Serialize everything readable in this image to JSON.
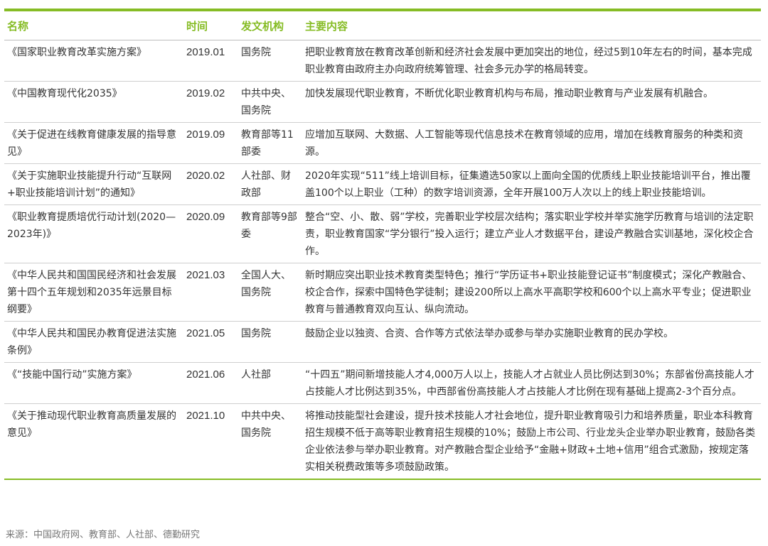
{
  "colors": {
    "accent": "#86bc25",
    "text": "#333333",
    "rule": "#cfcfcf"
  },
  "table": {
    "headers": {
      "name": "名称",
      "time": "时间",
      "org": "发文机构",
      "content": "主要内容"
    },
    "rows": [
      {
        "name": "《国家职业教育改革实施方案》",
        "time": "2019.01",
        "org": "国务院",
        "content": "把职业教育放在教育改革创新和经济社会发展中更加突出的地位，经过5到10年左右的时间，基本完成职业教育由政府主办向政府统筹管理、社会多元办学的格局转变。"
      },
      {
        "name": "《中国教育现代化2035》",
        "time": "2019.02",
        "org": "中共中央、国务院",
        "content": "加快发展现代职业教育，不断优化职业教育机构与布局，推动职业教育与产业发展有机融合。"
      },
      {
        "name": "《关于促进在线教育健康发展的指导意见》",
        "time": "2019.09",
        "org": "教育部等11 部委",
        "content": "应增加互联网、大数据、人工智能等现代信息技术在教育领域的应用，增加在线教育服务的种类和资源。"
      },
      {
        "name": "《关于实施职业技能提升行动“互联网+职业技能培训计划”的通知》",
        "time": "2020.02",
        "org": "人社部、财政部",
        "content": "2020年实现“511”线上培训目标，征集遴选50家以上面向全国的优质线上职业技能培训平台，推出覆盖100个以上职业（工种）的数字培训资源，全年开展100万人次以上的线上职业技能培训。"
      },
      {
        "name": "《职业教育提质培优行动计划(2020—2023年)》",
        "time": "2020.09",
        "org": "教育部等9部委",
        "content": "整合“空、小、散、弱”学校，完善职业学校层次结构；落实职业学校并举实施学历教育与培训的法定职责，职业教育国家“学分银行”投入运行；建立产业人才数据平台，建设产教融合实训基地，深化校企合作。"
      },
      {
        "name": "《中华人民共和国国民经济和社会发展第十四个五年规划和2035年远景目标纲要》",
        "time": "2021.03",
        "org": "全国人大、国务院",
        "content": "新时期应突出职业技术教育类型特色；推行“学历证书+职业技能登记证书”制度模式；深化产教融合、校企合作，探索中国特色学徒制；建设200所以上高水平高职学校和600个以上高水平专业；促进职业教育与普通教育双向互认、纵向流动。"
      },
      {
        "name": "《中华人民共和国民办教育促进法实施条例》",
        "time": "2021.05",
        "org": "国务院",
        "content": "鼓励企业以独资、合资、合作等方式依法举办或参与举办实施职业教育的民办学校。"
      },
      {
        "name": "《“技能中国行动”实施方案》",
        "time": "2021.06",
        "org": "人社部",
        "content": "“十四五”期间新增技能人才4,000万人以上，技能人才占就业人员比例达到30%；东部省份高技能人才占技能人才比例达到35%，中西部省份高技能人才占技能人才比例在现有基础上提高2-3个百分点。"
      },
      {
        "name": "《关于推动现代职业教育高质量发展的意见》",
        "time": "2021.10",
        "org": "中共中央、国务院",
        "content": "将推动技能型社会建设，提升技术技能人才社会地位，提升职业教育吸引力和培养质量，职业本科教育招生规模不低于高等职业教育招生规模的10%；鼓励上市公司、行业龙头企业举办职业教育，鼓励各类企业依法参与举办职业教育。对产教融合型企业给予“金融+财政+土地+信用”组合式激励，按规定落实相关税费政策等多项鼓励政策。"
      }
    ]
  },
  "source": "来源：中国政府网、教育部、人社部、德勤研究"
}
